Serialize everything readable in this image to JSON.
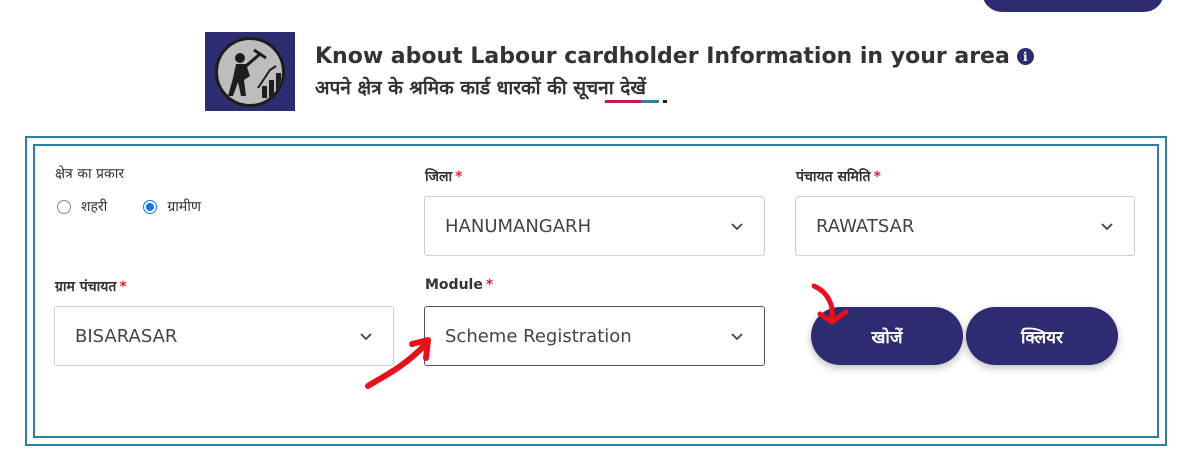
{
  "header": {
    "title_en": "Know about Labour cardholder Information in your area",
    "title_hi": "अपने क्षेत्र के श्रमिक कार्ड धारकों की सूचना देखें",
    "info_icon": "i",
    "underline_colors": [
      "#c2185b",
      "#2f7fa0",
      "#1d1d1d"
    ]
  },
  "form": {
    "area_type": {
      "label": "क्षेत्र का प्रकार",
      "options": [
        {
          "label": "शहरी",
          "checked": false
        },
        {
          "label": "ग्रामीण",
          "checked": true
        }
      ]
    },
    "district": {
      "label": "जिला",
      "required": "*",
      "value": "HANUMANGARH"
    },
    "panchayat_samiti": {
      "label": "पंचायत समिति",
      "required": "*",
      "value": "RAWATSAR"
    },
    "gram_panchayat": {
      "label": "ग्राम पंचायत",
      "required": "*",
      "value": "BISARASAR"
    },
    "module": {
      "label": "Module",
      "required": "*",
      "value": "Scheme Registration"
    }
  },
  "buttons": {
    "search": "खोजें",
    "clear": "क्लियर"
  },
  "colors": {
    "brand": "#2e2c70",
    "border": "#2f7fa0",
    "required": "#e0213a",
    "annotation": "#e8101b",
    "radio_selected": "#1473e6"
  }
}
